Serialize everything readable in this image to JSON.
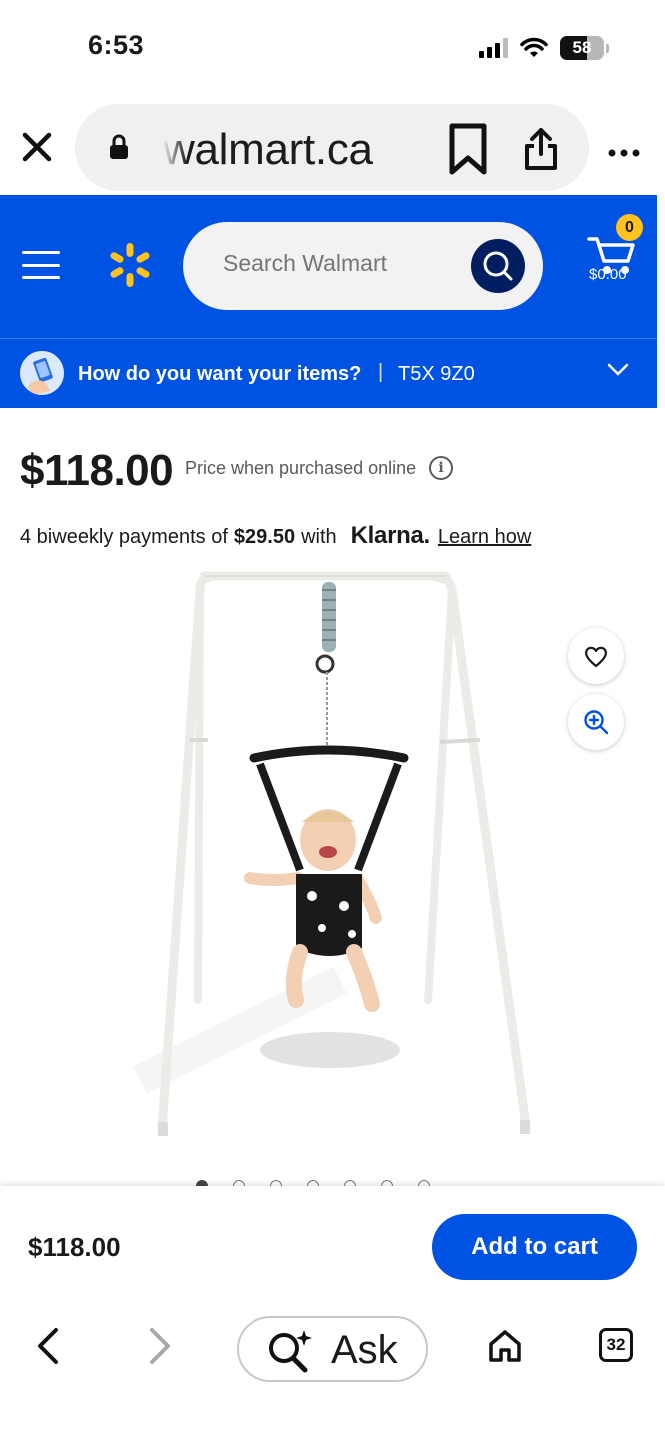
{
  "status_bar": {
    "time": "6:53",
    "battery_level": "58"
  },
  "browser": {
    "url": "walmart.ca",
    "icons": [
      "close-icon",
      "lock-icon",
      "bookmark-icon",
      "share-icon",
      "more-icon"
    ]
  },
  "header": {
    "search_placeholder": "Search Walmart",
    "cart_count": "0",
    "cart_total": "$0.00",
    "brand_color": "#0053e2",
    "spark_color": "#ffc220"
  },
  "delivery": {
    "question": "How do you want your items?",
    "separator": "|",
    "postal_code": "T5X 9Z0"
  },
  "product": {
    "price": "$118.00",
    "price_note": "Price when purchased online",
    "klarna": {
      "prefix": "4 biweekly payments of",
      "amount": "$29.50",
      "with_text": "with",
      "brand": "Klarna.",
      "link_text": "Learn how"
    },
    "image_count": 7,
    "active_image_index": 0
  },
  "sticky_bar": {
    "price": "$118.00",
    "add_to_cart_label": "Add to cart"
  },
  "bottom_toolbar": {
    "ask_label": "Ask",
    "tab_count": "32"
  }
}
